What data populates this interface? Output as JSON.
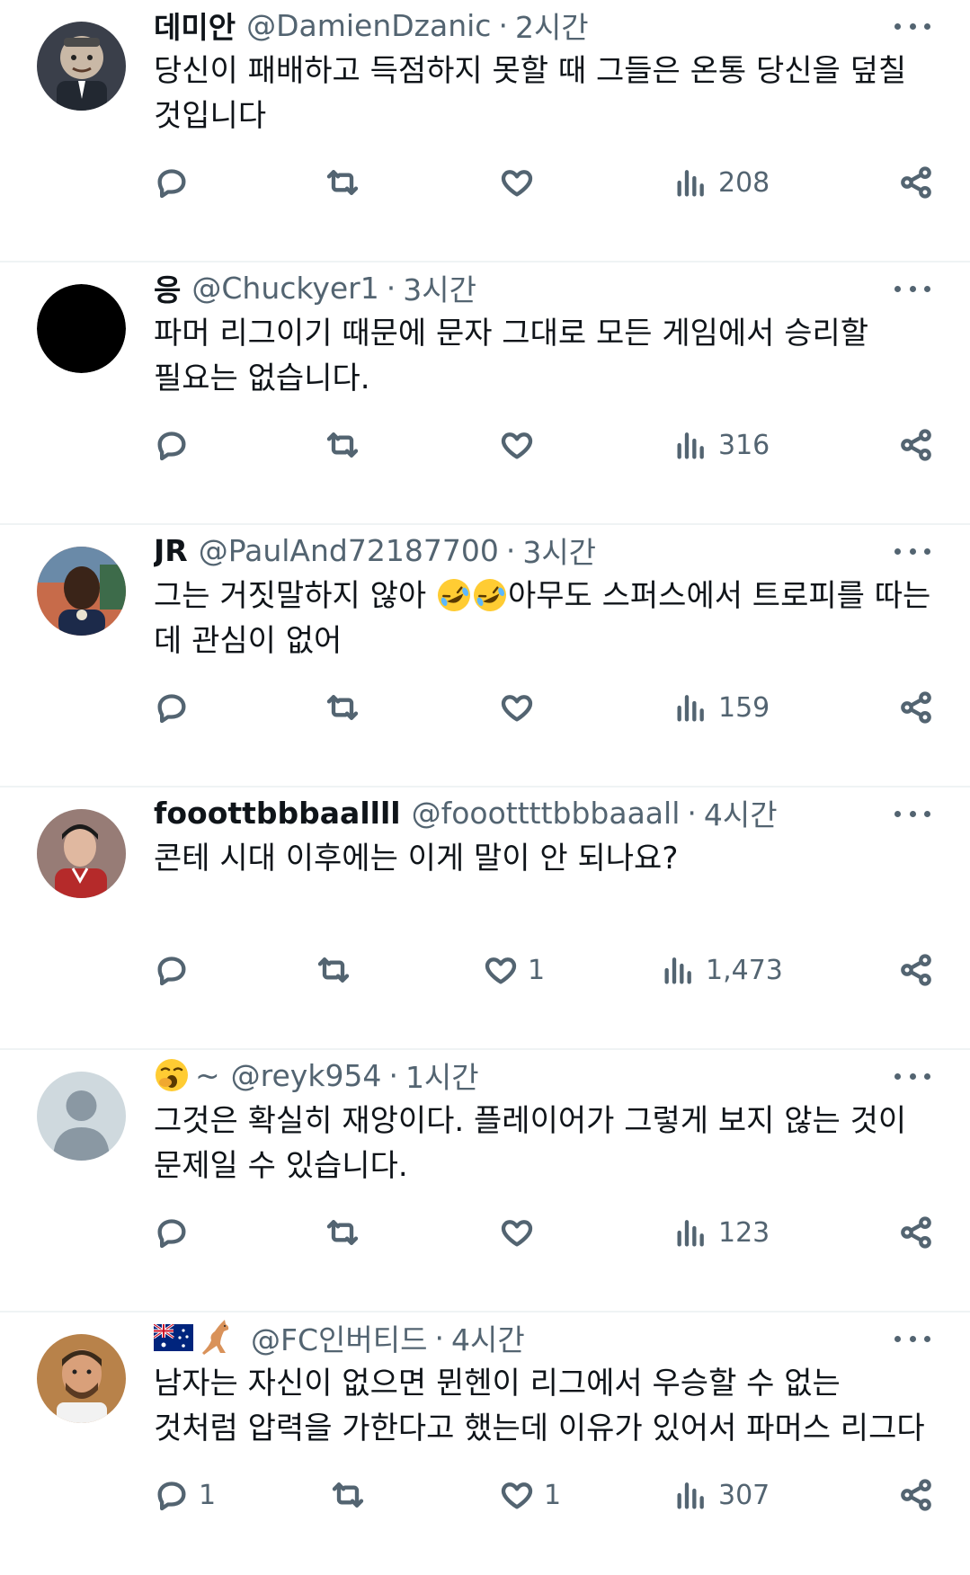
{
  "tweets": [
    {
      "name": "데미안",
      "handle": "@DamienDzanic",
      "time": "2시간",
      "text": "당신이 패배하고 득점하지 못할 때 그들은 온통 당신을 덮칠 것입니다",
      "replies": "",
      "retweets": "",
      "likes": "",
      "views": "208",
      "avatar": "cartoon-character"
    },
    {
      "name": "응",
      "handle": "@Chuckyer1",
      "time": "3시간",
      "text": "파머 리그이기 때문에 문자 그대로 모든 게임에서 승리할 필요는 없습니다.",
      "replies": "",
      "retweets": "",
      "likes": "",
      "views": "316",
      "avatar": "black-circle"
    },
    {
      "name": "JR",
      "handle": "@PaulAnd72187700",
      "time": "3시간",
      "text_before": "그는 거짓말하지 않아 ",
      "text_emoji": "rolling-on-floor-laughing-emoji x2",
      "text_after": "아무도 스퍼스에서 트로피를 따는 데 관심이 없어",
      "replies": "",
      "retweets": "",
      "likes": "",
      "views": "159",
      "avatar": "person-photo"
    },
    {
      "name": "fooottbbbaallll",
      "handle": "@fooottttbbbaaall",
      "time": "4시간",
      "text": "콘테 시대 이후에는 이게 말이 안 되나요?",
      "replies": "",
      "retweets": "",
      "likes": "1",
      "views": "1,473",
      "avatar": "person-photo-red"
    },
    {
      "name_emoji": "yawning-face-emoji",
      "name": "~",
      "handle": "@reyk954",
      "time": "1시간",
      "text": "그것은 확실히 재앙이다. 플레이어가 그렇게 보지 않는 것이 문제일 수 있습니다.",
      "replies": "",
      "retweets": "",
      "likes": "",
      "views": "123",
      "avatar": "default-avatar"
    },
    {
      "name_emoji": "australia-flag kangaroo",
      "name": "",
      "handle": "@FC인버티드",
      "time": "4시간",
      "text": "남자는 자신이 없으면 뮌헨이 리그에서 우승할 수 없는 것처럼 압력을 가한다고 했는데 이유가 있어서 파머스 리그다",
      "replies": "1",
      "retweets": "",
      "likes": "1",
      "views": "307",
      "avatar": "person-photo-beard"
    }
  ],
  "colors": {
    "text": "#0f1419",
    "secondary": "#536471",
    "divider": "#eff3f4"
  }
}
